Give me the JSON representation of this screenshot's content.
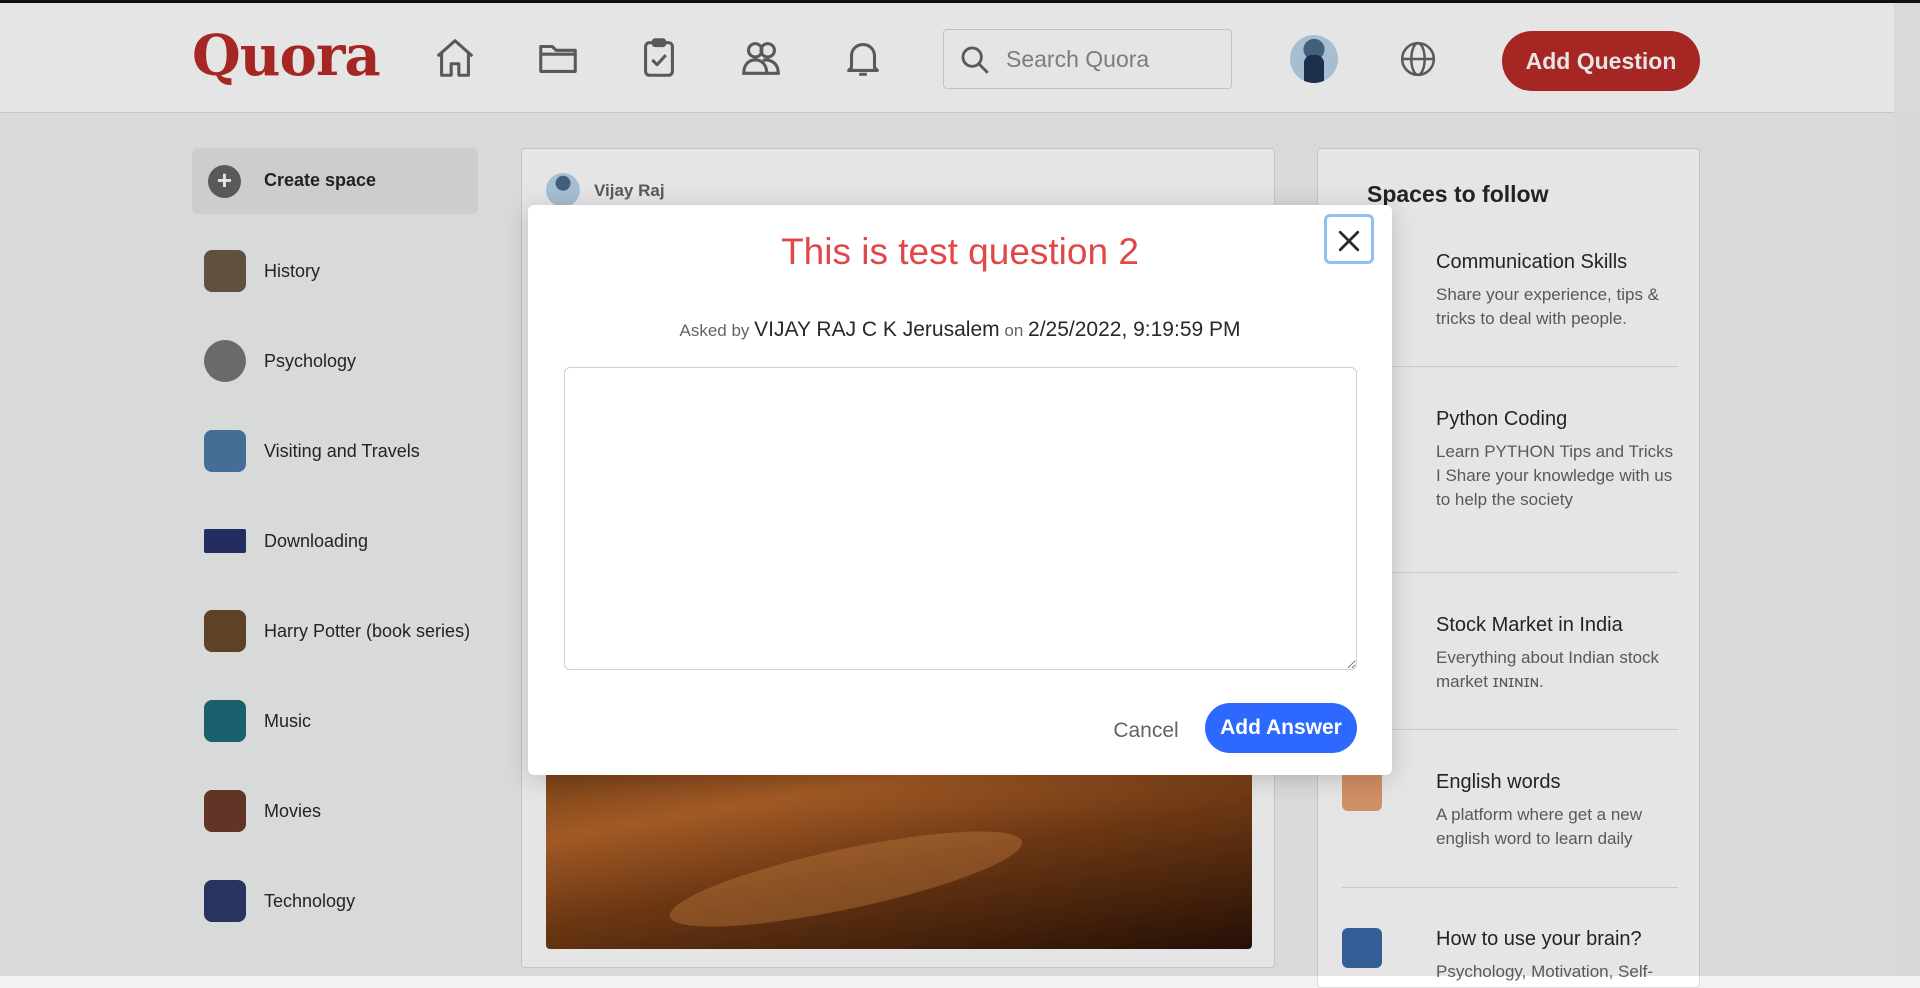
{
  "header": {
    "logo": "Quora",
    "nav_icons": [
      "home-icon",
      "folder-icon",
      "clipboard-check-icon",
      "people-icon",
      "bell-icon"
    ],
    "search_placeholder": "Search Quora",
    "add_question_label": "Add Question",
    "brand_color": "#b92b27"
  },
  "sidebar": {
    "create_space_label": "Create space",
    "items": [
      {
        "label": "History",
        "color": "#6b5a48"
      },
      {
        "label": "Psychology",
        "color": "#777777"
      },
      {
        "label": "Visiting and Travels",
        "color": "#4e7aa8"
      },
      {
        "label": "Downloading",
        "color": "#28336b"
      },
      {
        "label": "Harry Potter (book series)",
        "color": "#6a4a2a"
      },
      {
        "label": "Music",
        "color": "#1f6a7a"
      },
      {
        "label": "Movies",
        "color": "#6b3b2a"
      },
      {
        "label": "Technology",
        "color": "#2d3a6a"
      }
    ]
  },
  "feed": {
    "user_name": "Vijay Raj"
  },
  "right_panel": {
    "title": "Spaces to follow",
    "items": [
      {
        "name": "Communication Skills",
        "desc": "Share your experience, tips & tricks to deal with people.",
        "color": "#f2c230"
      },
      {
        "name": "Python Coding",
        "desc": "Learn PYTHON Tips and Tricks I Share your knowledge with us to help the society",
        "color": "#111111"
      },
      {
        "name": "Stock Market in India",
        "desc": "Everything about Indian stock market ɪɴɪɴɪɴ.",
        "color": "#8a5a2a"
      },
      {
        "name": "English words",
        "desc": "A platform where get a new english word to learn daily",
        "color": "#e8a070"
      },
      {
        "name": "How to use your brain?",
        "desc": "Psychology, Motivation, Self-",
        "color": "#3a6aa8"
      }
    ]
  },
  "modal": {
    "title": "This is test question 2",
    "asked_prefix": "Asked by",
    "asked_by": "VIJAY RAJ C K Jerusalem",
    "on_label": "on",
    "date": "2/25/2022, 9:19:59 PM",
    "answer_value": "",
    "cancel_label": "Cancel",
    "add_answer_label": "Add Answer",
    "title_color": "#e04848",
    "accent_color": "#2e69ff"
  }
}
